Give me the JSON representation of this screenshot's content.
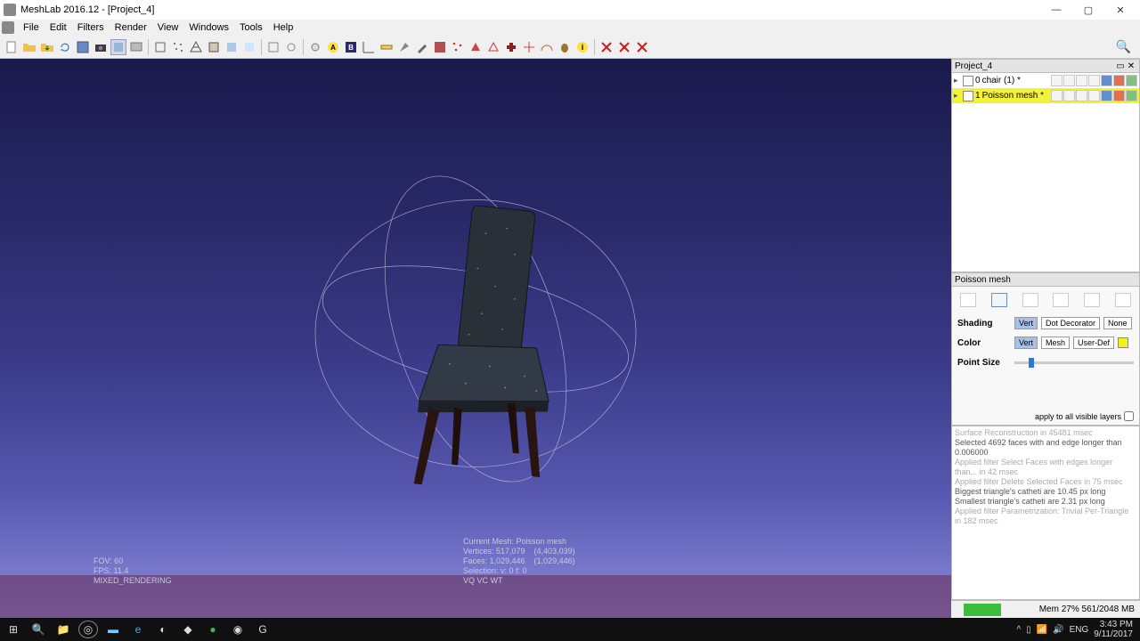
{
  "titlebar": {
    "text": "MeshLab 2016.12 - [Project_4]"
  },
  "menu": [
    "File",
    "Edit",
    "Filters",
    "Render",
    "View",
    "Windows",
    "Tools",
    "Help"
  ],
  "panels": {
    "layers_title": "Project_4",
    "layers": [
      {
        "idx": "0",
        "name": "chair (1) *",
        "selected": false
      },
      {
        "idx": "1",
        "name": "Poisson mesh *",
        "selected": true
      }
    ],
    "props_title": "Poisson mesh",
    "shading_label": "Shading",
    "shading_opts": [
      "Vert",
      "Dot Decorator",
      "None"
    ],
    "color_label": "Color",
    "color_opts": [
      "Vert",
      "Mesh",
      "User-Def"
    ],
    "pointsize_label": "Point Size",
    "apply_label": "apply to all visible layers"
  },
  "log_lines": [
    {
      "t": "Surface Reconstruction in 45481 msec",
      "dim": true
    },
    {
      "t": "Selected 4692 faces with and edge longer than 0.006000",
      "dim": false
    },
    {
      "t": "Applied filter Select Faces with edges longer than... in 42 msec",
      "dim": true
    },
    {
      "t": "Applied filter Delete Selected Faces in 75 msec",
      "dim": true
    },
    {
      "t": "Biggest triangle's catheti are 10.45 px long",
      "dim": false
    },
    {
      "t": "Smallest triangle's catheti are 2.31 px long",
      "dim": false
    },
    {
      "t": "Applied filter Parametrization: Trivial Per-Triangle in 182 msec",
      "dim": true
    }
  ],
  "hud": {
    "fov": "FOV: 60",
    "fps": "FPS: 11.4",
    "mode": "MIXED_RENDERING",
    "mesh": "Current Mesh: Poisson mesh",
    "verts": "Vertices: 517,079    (4,403,039)",
    "faces": "Faces: 1,029,446    (1,029,446)",
    "sel": "Selection: v: 0 f: 0",
    "flags": "VQ VC WT"
  },
  "status": {
    "mem": "Mem 27% 561/2048 MB"
  },
  "tray": {
    "lang": "ENG",
    "time": "3:43 PM",
    "date": "9/11/2017"
  }
}
